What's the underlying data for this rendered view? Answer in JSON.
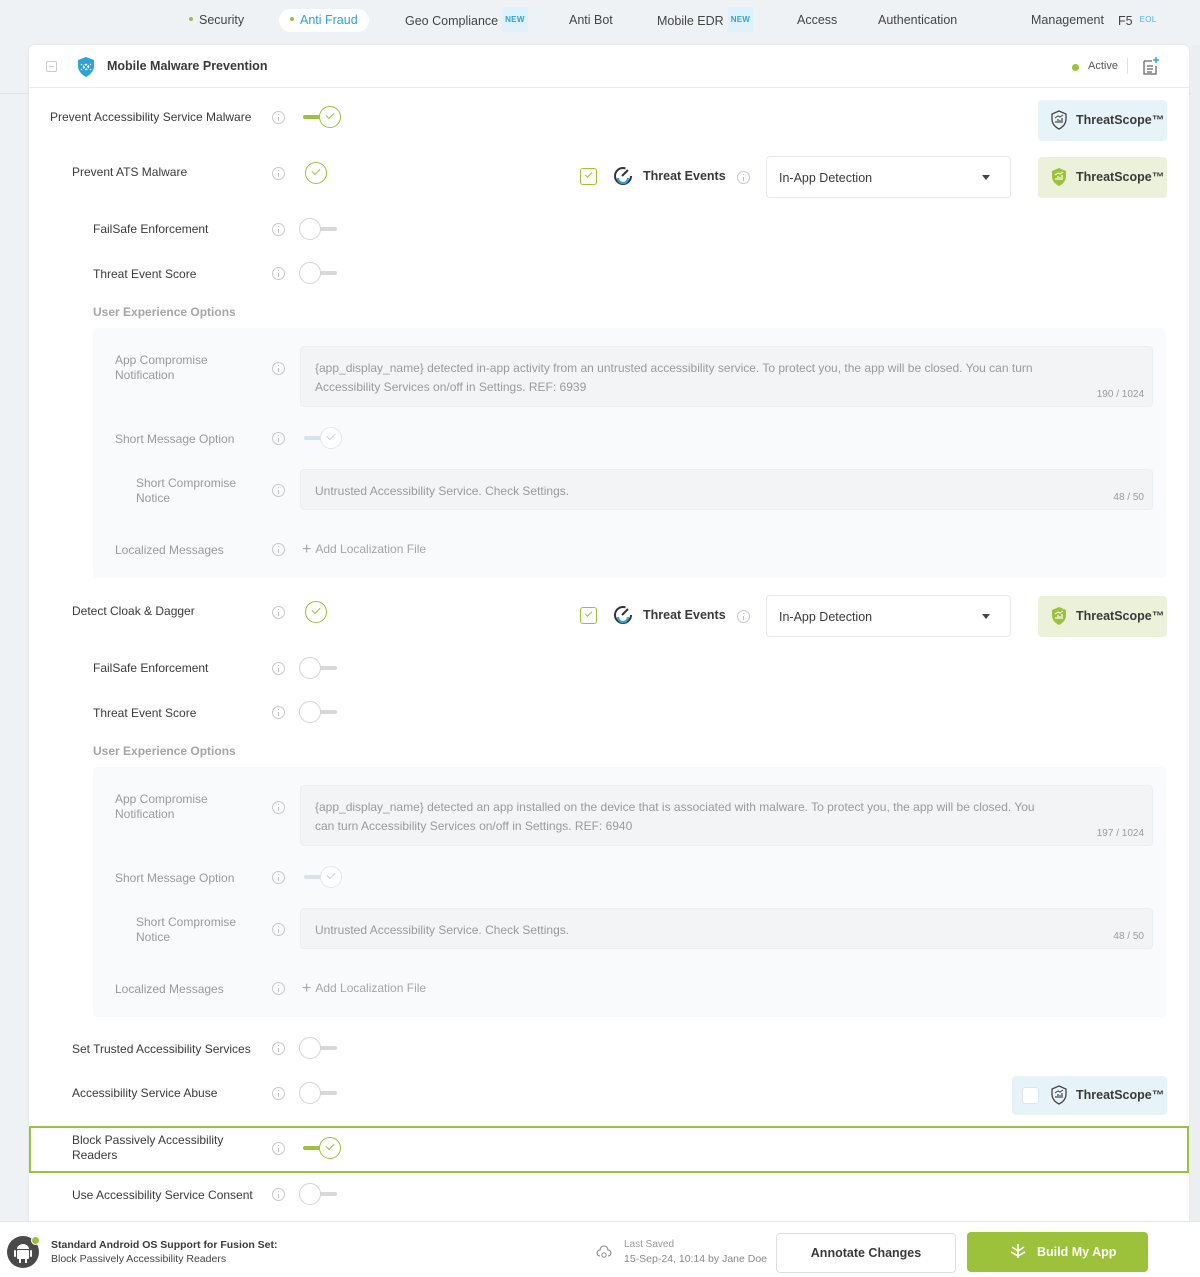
{
  "nav": {
    "tabs": [
      {
        "label": "Security",
        "dot": true,
        "active": false,
        "badge": ""
      },
      {
        "label": "Anti Fraud",
        "dot": true,
        "active": true,
        "badge": ""
      },
      {
        "label": "Geo Compliance",
        "dot": false,
        "active": false,
        "badge": "NEW"
      },
      {
        "label": "Anti Bot",
        "dot": false,
        "active": false,
        "badge": ""
      },
      {
        "label": "Mobile EDR",
        "dot": false,
        "active": false,
        "badge": "NEW"
      },
      {
        "label": "Access",
        "dot": false,
        "active": false,
        "badge": ""
      },
      {
        "label": "Authentication",
        "dot": false,
        "active": false,
        "badge": ""
      },
      {
        "label": "Management",
        "dot": false,
        "active": false,
        "badge": ""
      },
      {
        "label": "F5",
        "dot": false,
        "active": false,
        "badge": "EOL"
      }
    ]
  },
  "card": {
    "title": "Mobile Malware Prevention",
    "status": "Active",
    "status_color": "#9cc13a"
  },
  "colors": {
    "accent_green": "#9cc13a",
    "accent_blue": "#2ea3d6",
    "threatscope_blue_bg": "#e6f4fa",
    "threatscope_green_bg": "#ecf2d9"
  },
  "features": {
    "prevent_asm": {
      "label": "Prevent Accessibility Service Malware",
      "enabled": true,
      "threatscope": "ThreatScope™"
    },
    "ats": {
      "label": "Prevent ATS Malware",
      "enabled": true,
      "threat_events_checked": true,
      "threat_events_label": "Threat Events",
      "detection_select": "In-App Detection",
      "threatscope": "ThreatScope™",
      "failsafe": {
        "label": "FailSafe Enforcement",
        "enabled": false
      },
      "score": {
        "label": "Threat Event Score",
        "enabled": false
      },
      "ux_heading": "User Experience Options",
      "ux": {
        "compromise_label": "App Compromise Notification",
        "compromise_text": "{app_display_name} detected in-app activity from an untrusted accessibility service. To protect you, the app will be closed. You can turn Accessibility Services on/off in Settings. REF: 6939",
        "compromise_count": "190 / 1024",
        "short_option_label": "Short Message Option",
        "short_option_enabled": true,
        "short_notice_label": "Short Compromise Notice",
        "short_notice_text": "Untrusted Accessibility Service. Check Settings.",
        "short_notice_count": "48 / 50",
        "localized_label": "Localized Messages",
        "add_localization": "Add Localization File"
      }
    },
    "cloak": {
      "label": "Detect Cloak & Dagger",
      "enabled": true,
      "threat_events_checked": true,
      "threat_events_label": "Threat Events",
      "detection_select": "In-App Detection",
      "threatscope": "ThreatScope™",
      "failsafe": {
        "label": "FailSafe Enforcement",
        "enabled": false
      },
      "score": {
        "label": "Threat Event Score",
        "enabled": false
      },
      "ux_heading": "User Experience Options",
      "ux": {
        "compromise_label": "App Compromise Notification",
        "compromise_text": "{app_display_name} detected an app installed on the device that is associated with malware. To protect you, the app will be closed. You can turn Accessibility Services on/off in Settings. REF: 6940",
        "compromise_count": "197 / 1024",
        "short_option_label": "Short Message Option",
        "short_option_enabled": true,
        "short_notice_label": "Short Compromise Notice",
        "short_notice_text": "Untrusted Accessibility Service. Check Settings.",
        "short_notice_count": "48 / 50",
        "localized_label": "Localized Messages",
        "add_localization": "Add Localization File"
      }
    },
    "trusted": {
      "label": "Set Trusted Accessibility Services",
      "enabled": false
    },
    "abuse": {
      "label": "Accessibility Service Abuse",
      "enabled": false,
      "threatscope": "ThreatScope™",
      "threatscope_checked": false
    },
    "passive": {
      "label": "Block Passively Accessibility Readers",
      "enabled": true
    },
    "consent": {
      "label": "Use Accessibility Service Consent",
      "enabled": false
    }
  },
  "footer": {
    "title": "Standard Android OS Support for Fusion Set:",
    "subtitle": "Block Passively Accessibility Readers",
    "last_saved_label": "Last Saved",
    "last_saved_value": "15-Sep-24, 10:14 by Jane Doe",
    "annotate_label": "Annotate Changes",
    "build_label": "Build My App"
  }
}
